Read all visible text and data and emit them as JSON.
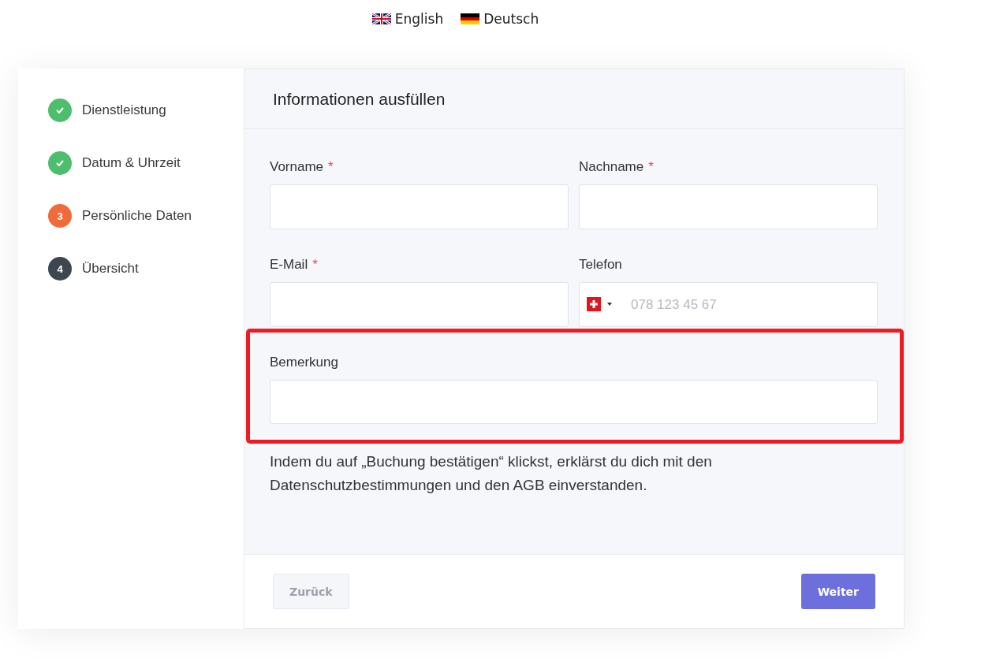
{
  "languages": [
    {
      "label": "English",
      "kind": "uk"
    },
    {
      "label": "Deutsch",
      "kind": "de"
    }
  ],
  "steps": [
    {
      "label": "Dienstleistung",
      "kind": "done"
    },
    {
      "label": "Datum & Uhrzeit",
      "kind": "done"
    },
    {
      "number": "3",
      "label": "Persönliche Daten",
      "kind": "current"
    },
    {
      "number": "4",
      "label": "Übersicht",
      "kind": "pending"
    }
  ],
  "form": {
    "title": "Informationen ausfüllen",
    "fields": [
      {
        "label": "Vorname",
        "required_mark": "*",
        "kind": "text"
      },
      {
        "label": "Nachname",
        "required_mark": "*",
        "kind": "text"
      },
      {
        "label": "E-Mail",
        "required_mark": "*",
        "kind": "text"
      },
      {
        "label": "Telefon",
        "kind": "phone",
        "placeholder": "078 123 45 67"
      },
      {
        "label": "Bemerkung",
        "kind": "wide",
        "highlighted": true
      }
    ],
    "consent": "Indem du auf „Buchung bestätigen“ klickst, erklärst du dich mit den Datenschutzbestimmungen und den AGB einverstanden."
  },
  "buttons": [
    {
      "label": "Zurück",
      "kind": "back",
      "disabled": true
    },
    {
      "label": "Weiter",
      "kind": "next",
      "disabled": false
    }
  ]
}
